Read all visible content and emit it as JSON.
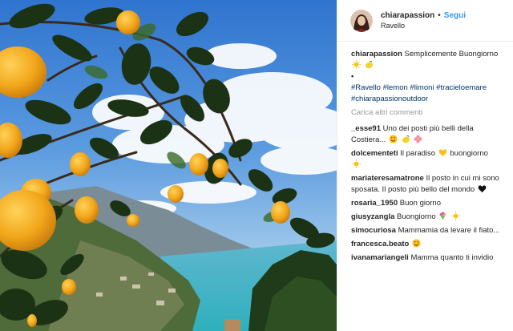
{
  "post": {
    "username": "chiarapassion",
    "follow_label": "Segui",
    "location": "Ravello"
  },
  "caption": {
    "username": "chiarapassion",
    "text": "Semplicemente Buongiorno",
    "emojis": [
      "sun-icon",
      "lemon-icon"
    ],
    "bullet": "•",
    "hashtags": [
      "#Ravello",
      "#lemon",
      "#limoni",
      "#tracieloemare",
      "#chiarapassionoutdoor"
    ]
  },
  "load_more_label": "Carica altri commenti",
  "comments": [
    {
      "user": "_esse91",
      "text": "Uno dei posti più belli della Costiera...",
      "emojis": [
        "heart-eyes-icon",
        "lemon-icon",
        "flower-icon"
      ]
    },
    {
      "user": "dolcementeti",
      "text": "Il paradiso",
      "text2": "buongiorno",
      "emojis": [
        "yellow-heart-icon",
        "sun-icon"
      ]
    },
    {
      "user": "mariateresamatrone",
      "text": "Il posto in cui mi sono sposata. Il posto più bello del mondo",
      "emojis": [
        "black-heart-icon"
      ]
    },
    {
      "user": "rosaria_1950",
      "text": "Buon giorno"
    },
    {
      "user": "giusyzangla",
      "text": "Buongiorno",
      "emojis": [
        "bouquet-icon",
        "sun-icon"
      ]
    },
    {
      "user": "simocuriosa",
      "text": "Mammamia da levare il fiato..."
    },
    {
      "user": "francesca.beato",
      "text": "",
      "emojis": [
        "heart-eyes-icon"
      ]
    },
    {
      "user": "ivanamariangeli",
      "text": "Mamma quanto ti invidio"
    }
  ],
  "colors": {
    "link": "#3897f0",
    "hashtag": "#003569",
    "muted": "#999999",
    "sky": "#3f86d8",
    "sea": "#3fb7c4",
    "lemon": "#f2a71b",
    "leaf": "#1f3b1a"
  }
}
